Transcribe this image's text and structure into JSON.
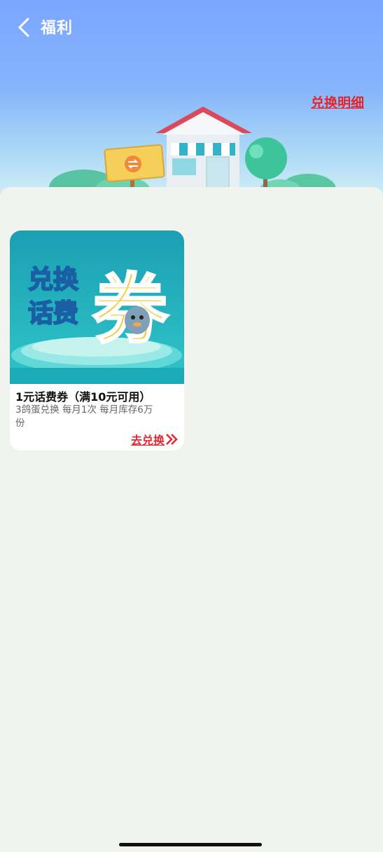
{
  "nav": {
    "title": "福利"
  },
  "header": {
    "detail_link": "兑换明细"
  },
  "card": {
    "banner_text_left": [
      "兑换",
      "话费"
    ],
    "banner_text_big": "券",
    "title": "1元话费券（满10元可用）",
    "description": "3鸽蛋兑换 每月1次 每月库存6万份",
    "action_label": "去兑换",
    "action_icon": "double-chevron-right-icon"
  },
  "colors": {
    "accent_red": "#e02a2f",
    "header_blue": "#7aa6ff",
    "banner_teal": "#16a9b7",
    "background": "#f1f3ef"
  }
}
